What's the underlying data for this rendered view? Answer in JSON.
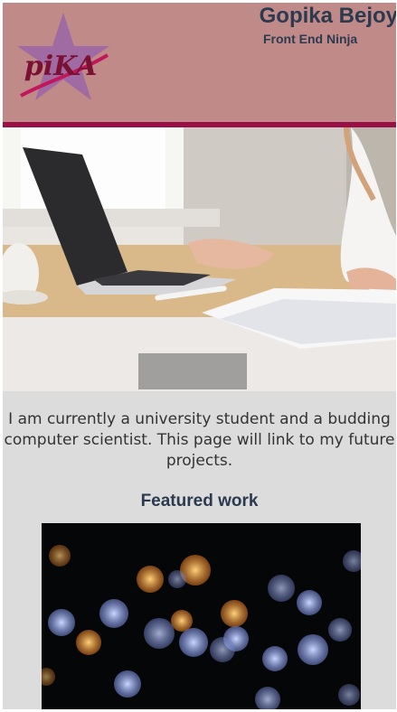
{
  "header": {
    "logo_text": "piKA",
    "name": "Gopika Bejoy",
    "tagline": "Front End Ninja"
  },
  "hero": {
    "description": "laptop-desk-photo"
  },
  "intro": {
    "text": "I am currently a university student and a budding computer scientist. This page will link to my future projects."
  },
  "featured": {
    "heading": "Featured work",
    "image": "bokeh-lights-photo"
  },
  "colors": {
    "header_bg": "#c08a89",
    "header_line": "#9a0f46",
    "page_bg": "#dcdcdc",
    "heading_text": "#2b3a4e",
    "logo_star": "#9a64a8"
  }
}
